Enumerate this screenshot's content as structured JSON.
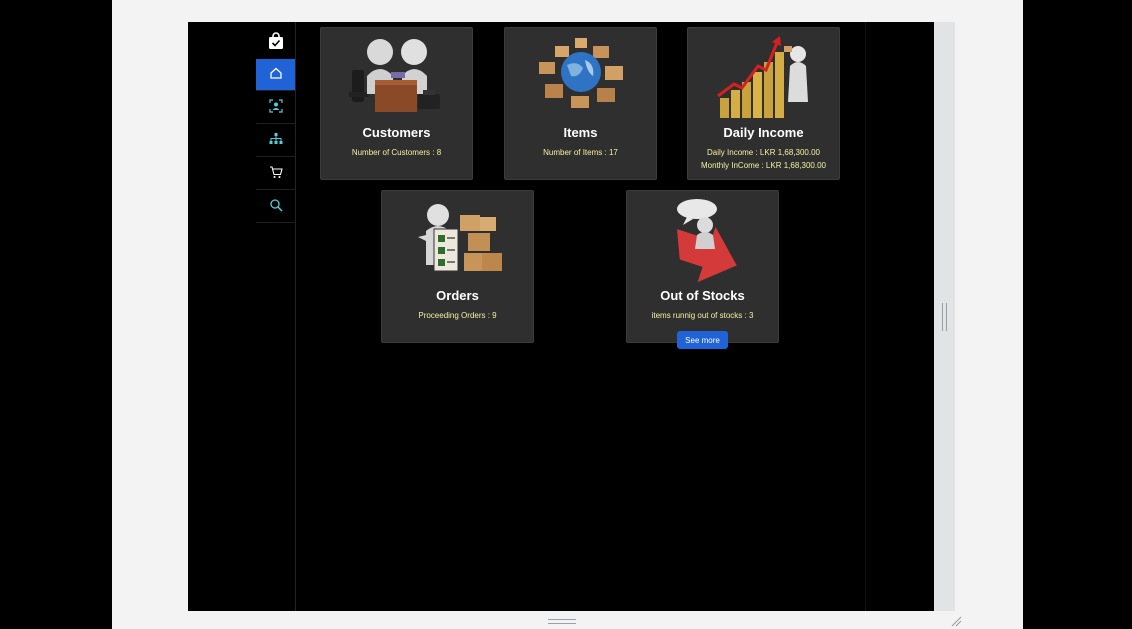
{
  "sidebar": {
    "items": [
      {
        "icon": "home-icon",
        "active": true
      },
      {
        "icon": "customer-icon",
        "active": false
      },
      {
        "icon": "sitemap-icon",
        "active": false
      },
      {
        "icon": "cart-icon",
        "active": false
      },
      {
        "icon": "search-icon",
        "active": false
      }
    ]
  },
  "cards": {
    "customers": {
      "title": "Customers",
      "stat": "Number of Customers : 8"
    },
    "items": {
      "title": "Items",
      "stat": "Number of Items : 17"
    },
    "income": {
      "title": "Daily Income",
      "stat_daily": "Daily Income : LKR 1,68,300.00",
      "stat_monthly": "Monthly InCome : LKR 1,68,300.00"
    },
    "orders": {
      "title": "Orders",
      "stat": "Proceeding Orders : 9"
    },
    "stocks": {
      "title": "Out of Stocks",
      "stat": "items runnig out of stocks : 3",
      "button": "See more"
    }
  },
  "colors": {
    "accent": "#1f63d6",
    "card_bg": "#2f2f2f",
    "stat_text": "#f2f2a0"
  }
}
